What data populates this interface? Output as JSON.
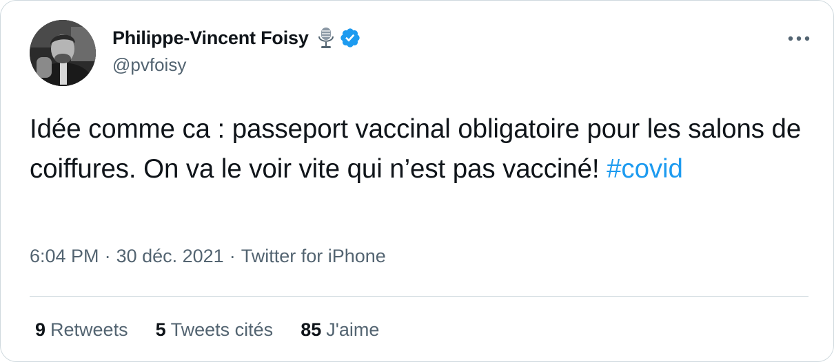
{
  "author": {
    "display_name": "Philippe-Vincent Foisy",
    "handle": "@pvfoisy",
    "badge_icons": [
      "microphone-icon",
      "verified-badge-icon"
    ],
    "verified_color": "#1d9bf0"
  },
  "tweet": {
    "text_main": "Idée comme ca : passeport vaccinal obligatoire pour les salons de coiffures. On va le voir vite qui n’est pas vacciné! ",
    "hashtag": "#covid",
    "time": "6:04 PM",
    "date": "30 déc. 2021",
    "source": "Twitter for iPhone",
    "separator": "·"
  },
  "stats": {
    "retweets_count": "9",
    "retweets_label": "Retweets",
    "quotes_count": "5",
    "quotes_label": "Tweets cités",
    "likes_count": "85",
    "likes_label": "J'aime"
  },
  "colors": {
    "text_primary": "#0f1419",
    "text_secondary": "#536471",
    "link": "#1d9bf0",
    "divider": "#cfd9de"
  }
}
